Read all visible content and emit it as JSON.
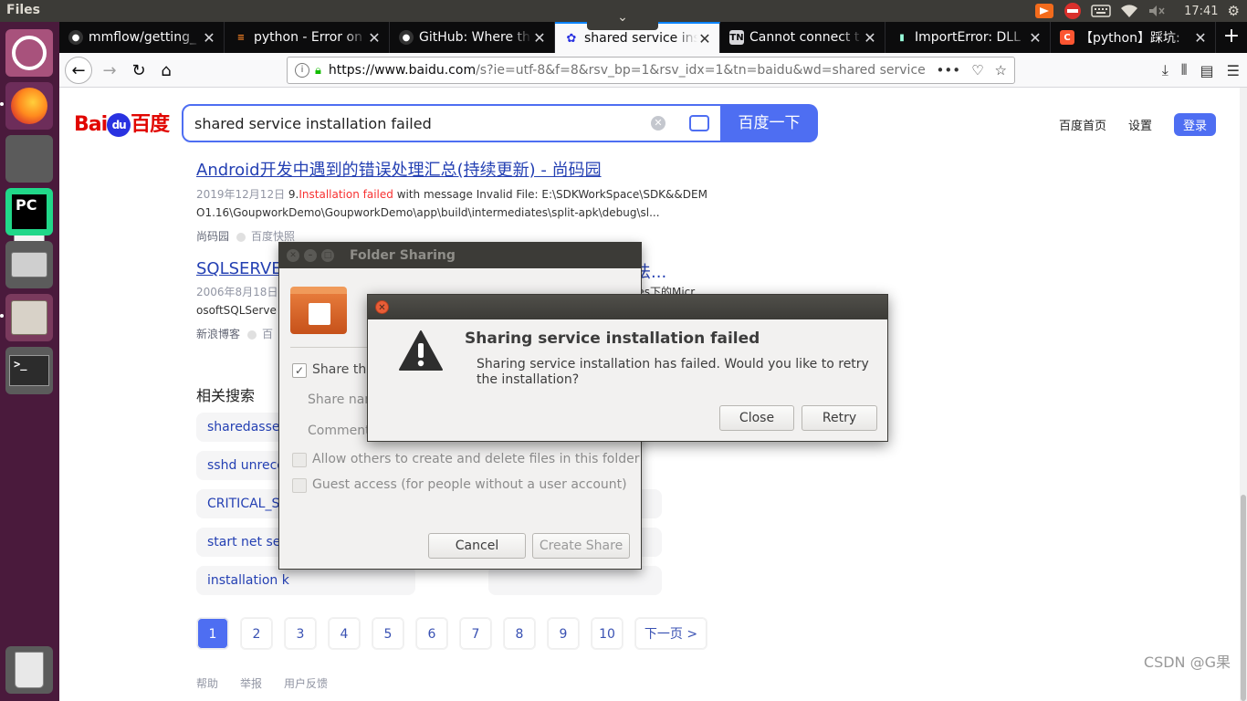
{
  "panel": {
    "app_name": "Files",
    "expander": "⌄",
    "clock": "17:41"
  },
  "launcher": {
    "pycharm_label": "PC",
    "terminal_label": ">_"
  },
  "browser": {
    "tabs": [
      {
        "title": "mmflow/getting_",
        "favicon": "github-icon"
      },
      {
        "title": "python - Error on ",
        "favicon": "stackoverflow-icon"
      },
      {
        "title": "GitHub: Where th",
        "favicon": "github-icon"
      },
      {
        "title": "shared service ins",
        "favicon": "baidu-paw-icon",
        "active": true
      },
      {
        "title": "Cannot connect t",
        "favicon": "tn-icon"
      },
      {
        "title": "ImportError: DLL",
        "favicon": "terminal-icon"
      },
      {
        "title": "【python】踩坑:",
        "favicon": "csdn-icon"
      }
    ],
    "url_host": "https://www.baidu.com",
    "url_path": "/s?ie=utf-8&f=8&rsv_bp=1&rsv_idx=1&tn=baidu&wd=shared service"
  },
  "baidu": {
    "logo_bai": "Bai",
    "logo_du": "du",
    "logo_cn": "百度",
    "query": "shared service installation failed",
    "search_button": "百度一下",
    "top_links": {
      "home": "百度首页",
      "settings": "设置",
      "login": "登录"
    },
    "results": [
      {
        "title": "Android开发中遇到的错误处理汇总(持续更新) - 尚码园",
        "date": "2019年12月12日",
        "snippet_pre": " 9.",
        "snippet_hl": "Installation failed",
        "snippet_post": " with message Invalid File: E:\\SDKWorkSpace\\SDK&&DEM",
        "snippet_line2": "O1.16\\GoupworkDemo\\GoupworkDemo\\app\\build\\intermediates\\split-apk\\debug\\sl...",
        "source": "尚码园",
        "cache": "百度快照"
      },
      {
        "title_left": "SQLSERVE",
        "title_right": "法...",
        "date": "2006年8月18日",
        "snippet_right": "les下的Micr",
        "snippet_line2": "osoftSQLServe",
        "source": "新浪博客",
        "cache": "百"
      }
    ],
    "related_title": "相关搜索",
    "related": [
      "sharedasset",
      "sshd unreco",
      "CRITICAL_S",
      "start net serv",
      "installation k"
    ],
    "pages": [
      "1",
      "2",
      "3",
      "4",
      "5",
      "6",
      "7",
      "8",
      "9",
      "10"
    ],
    "next_page": "下一页 >",
    "footer": [
      "帮助",
      "举报",
      "用户反馈"
    ]
  },
  "folder_sharing": {
    "title": "Folder Sharing",
    "share_this": "Share thi",
    "share_name_label": "Share nan",
    "comment_label": "Comment",
    "allow_others": "Allow others to create and delete files in this folder",
    "guest_access": "Guest access (for people without a user account)",
    "cancel": "Cancel",
    "create_share": "Create Share"
  },
  "error_dialog": {
    "heading": "Sharing service installation failed",
    "message": "Sharing service installation has failed. Would you like to retry the installation?",
    "close": "Close",
    "retry": "Retry"
  },
  "watermark": "CSDN @G果",
  "colors": {
    "ubuntu_panel": "#3c3b37",
    "baidu_blue": "#4e6ef2",
    "link_blue": "#2440b3",
    "highlight_red": "#f73131",
    "close_orange": "#e95d37"
  }
}
